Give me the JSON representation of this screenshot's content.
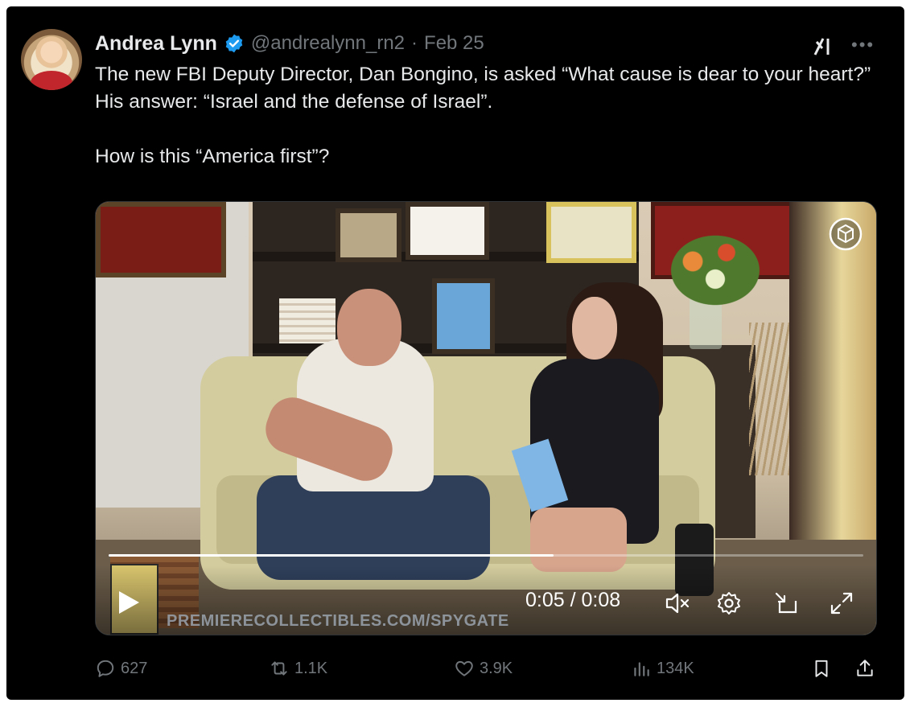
{
  "tweet": {
    "author_name": "Andrea Lynn",
    "handle": "@andrealynn_rn2",
    "separator": "·",
    "date": "Feb 25",
    "text_lines": [
      "The new FBI Deputy Director, Dan Bongino, is asked “What cause is dear to your heart?” His answer: “Israel and the defense of Israel”.",
      "How is this “America first”?"
    ]
  },
  "video": {
    "watermark": "PREMIERECOLLECTIBLES.COM/SPYGATE",
    "time": "0:05 / 0:08",
    "progress": 0.59,
    "controls": [
      "play-icon",
      "mute-icon",
      "settings-icon",
      "pip-icon",
      "fullscreen-icon"
    ]
  },
  "actions": {
    "replies": "627",
    "reposts": "1.1K",
    "likes": "3.9K",
    "views": "134K"
  },
  "colors": {
    "background": "#000000",
    "primary_text": "#e7e9ea",
    "secondary_text": "#71767b",
    "verified": "#1d9bf0"
  }
}
